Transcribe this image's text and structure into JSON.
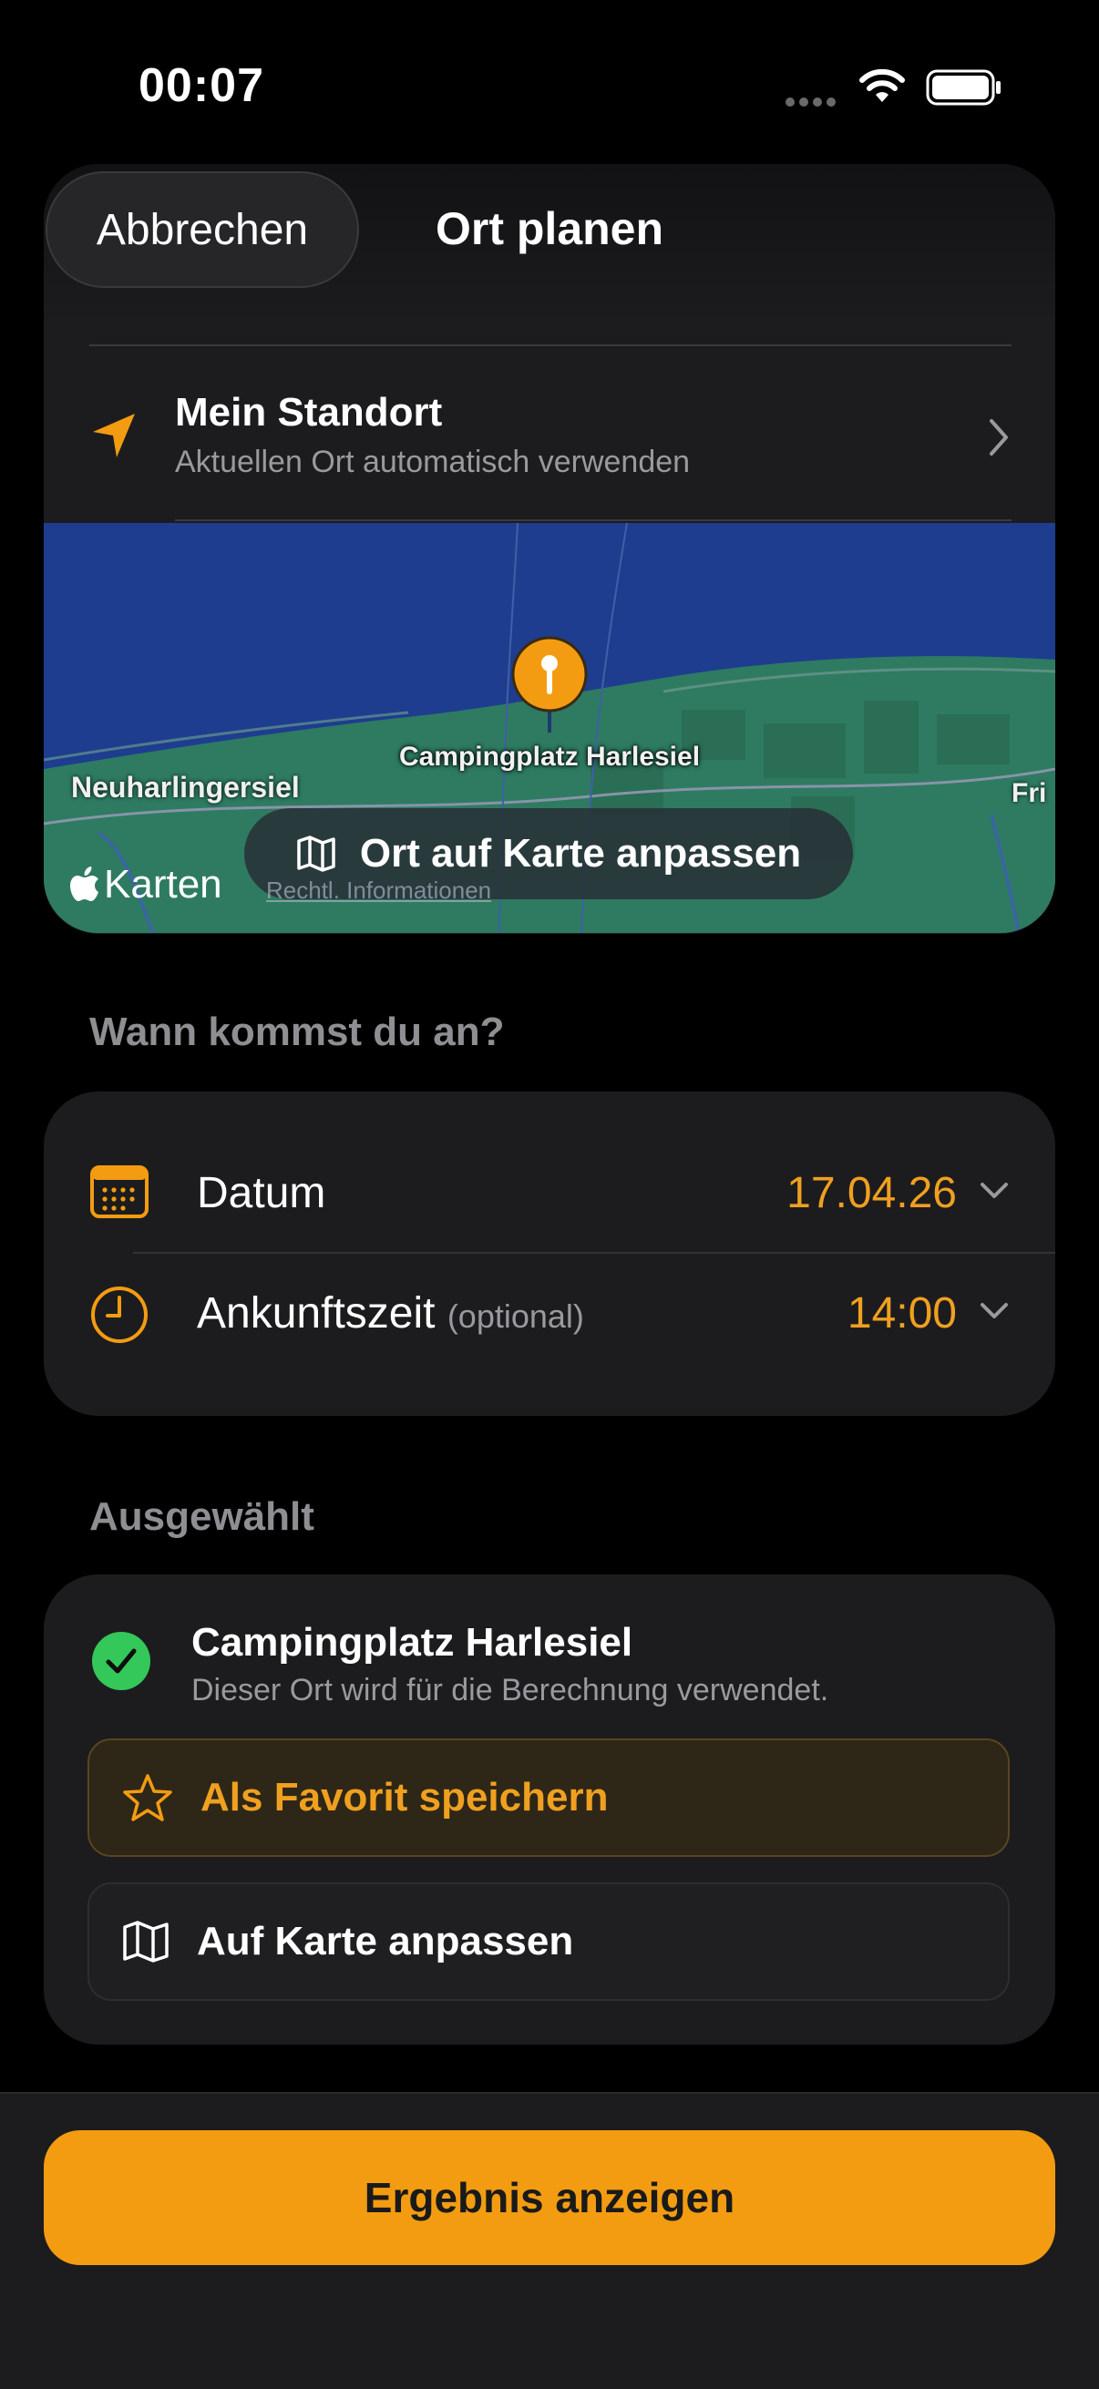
{
  "status_bar": {
    "time": "00:07"
  },
  "background_hint": "Wann kommst du an?",
  "header": {
    "cancel_label": "Abbrechen",
    "title": "Ort planen"
  },
  "my_location": {
    "title": "Mein Standort",
    "subtitle": "Aktuellen Ort automatisch verwenden",
    "icon": "location-arrow-icon"
  },
  "map": {
    "place_label": "Campingplatz Harlesiel",
    "town_left": "Neuharlingersiel",
    "town_right": "Fri",
    "adjust_label": "Ort auf Karte anpassen",
    "maps_logo": "Karten",
    "legal": "Rechtl. Informationen"
  },
  "arrival": {
    "section_label": "Wann kommst du an?",
    "date_label": "Datum",
    "date_value": "17.04.26",
    "time_label": "Ankunftszeit",
    "time_optional": "(optional)",
    "time_value": "14:00"
  },
  "selected": {
    "section_label": "Ausgewählt",
    "title": "Campingplatz Harlesiel",
    "subtitle": "Dieser Ort wird für die Berechnung verwendet.",
    "favorite_label": "Als Favorit speichern",
    "map_adjust_label": "Auf Karte anpassen"
  },
  "footer": {
    "result_label": "Ergebnis anzeigen"
  },
  "colors": {
    "accent": "#f39c12",
    "value": "#f0a020",
    "success": "#34c759",
    "card": "#1c1c1e"
  }
}
